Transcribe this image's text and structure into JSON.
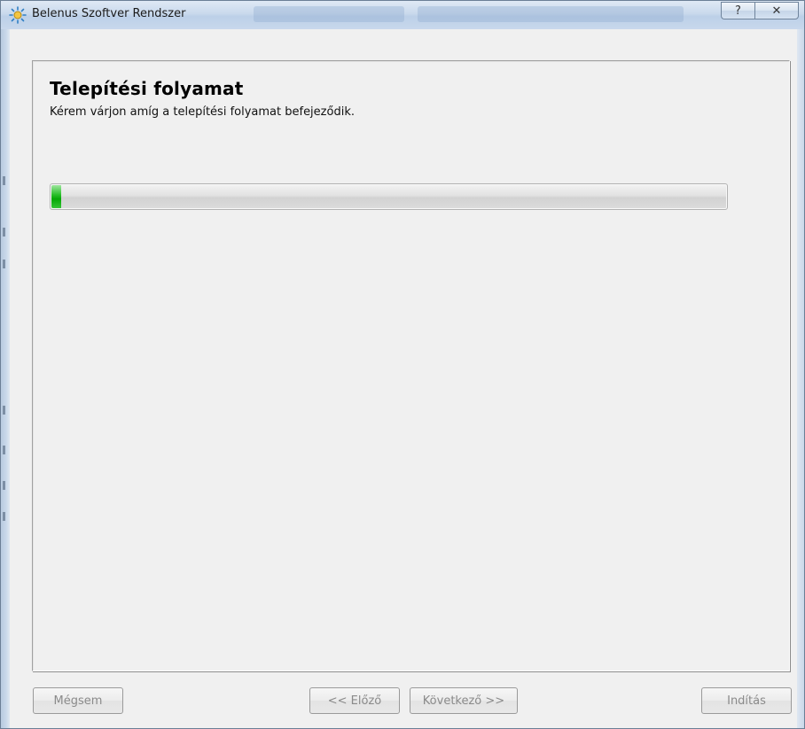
{
  "window": {
    "title": "Belenus Szoftver Rendszer",
    "icon": "belenus-app-icon",
    "help_glyph": "?",
    "close_glyph": "✕"
  },
  "page": {
    "title": "Telepítési folyamat",
    "subtitle": "Kérem várjon amíg a telepítési folyamat befejeződik."
  },
  "progress": {
    "fraction": 0.014,
    "fill_color": "#1fb81f"
  },
  "buttons": {
    "cancel": "Mégsem",
    "back": "<< Előző",
    "next": "Következő >>",
    "start": "Indítás"
  }
}
